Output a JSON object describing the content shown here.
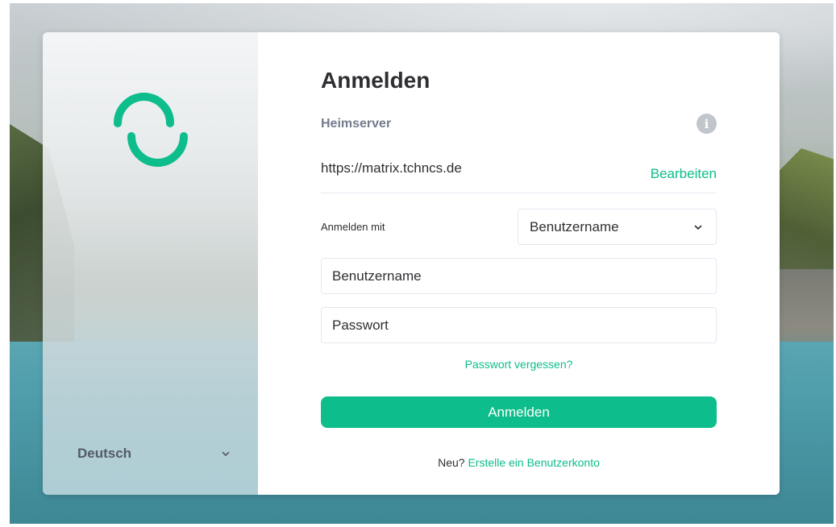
{
  "colors": {
    "accent": "#0dbd8b",
    "text_primary": "#2e2f32",
    "text_secondary": "#737d8c",
    "border": "#e3e8f0",
    "info_icon": "#c1c6cd"
  },
  "sidebar": {
    "logo_icon": "element-logo-icon",
    "language": {
      "selected": "Deutsch",
      "icon": "chevron-down-icon"
    }
  },
  "login": {
    "title": "Anmelden",
    "homeserver": {
      "label": "Heimserver",
      "info_icon": "info-icon",
      "url": "https://matrix.tchncs.de",
      "edit_label": "Bearbeiten"
    },
    "login_with": {
      "label": "Anmelden mit",
      "selected": "Benutzername",
      "icon": "chevron-down-icon"
    },
    "username_field": {
      "placeholder": "Benutzername",
      "value": ""
    },
    "password_field": {
      "placeholder": "Passwort",
      "value": ""
    },
    "forgot_password": "Passwort vergessen?",
    "submit_label": "Anmelden",
    "register": {
      "prefix": "Neu?",
      "link": "Erstelle ein Benutzerkonto"
    }
  }
}
